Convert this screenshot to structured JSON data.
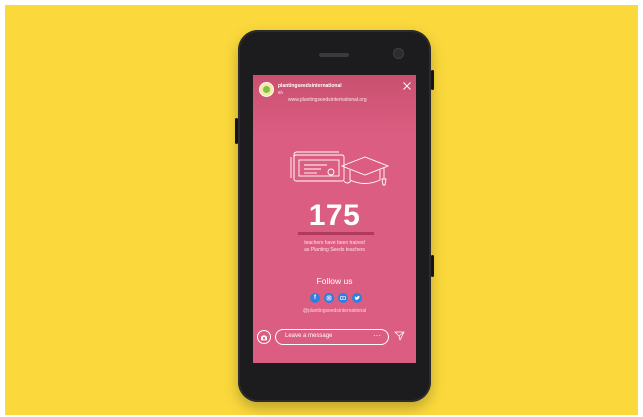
{
  "story": {
    "username": "plantingseedsinternational",
    "time_ago": "6h",
    "website": "www.plantingseedsinternational.org",
    "stat_value": "175",
    "caption_line1": "teachers have been trained",
    "caption_line2": "as Planting Seeds teachers",
    "follow_label": "Follow us",
    "handle": "@plantingseedsinternational"
  },
  "social_icons": [
    "facebook-icon",
    "instagram-icon",
    "youtube-icon",
    "twitter-icon"
  ],
  "reply": {
    "placeholder": "Leave a message",
    "more_label": "···"
  },
  "colors": {
    "background": "#fbd93c",
    "story_background": "#dc5d82",
    "phone_body": "#1c1c1e",
    "accent_bar": "#b03a5e",
    "social_blue": "#2f7fe0"
  }
}
